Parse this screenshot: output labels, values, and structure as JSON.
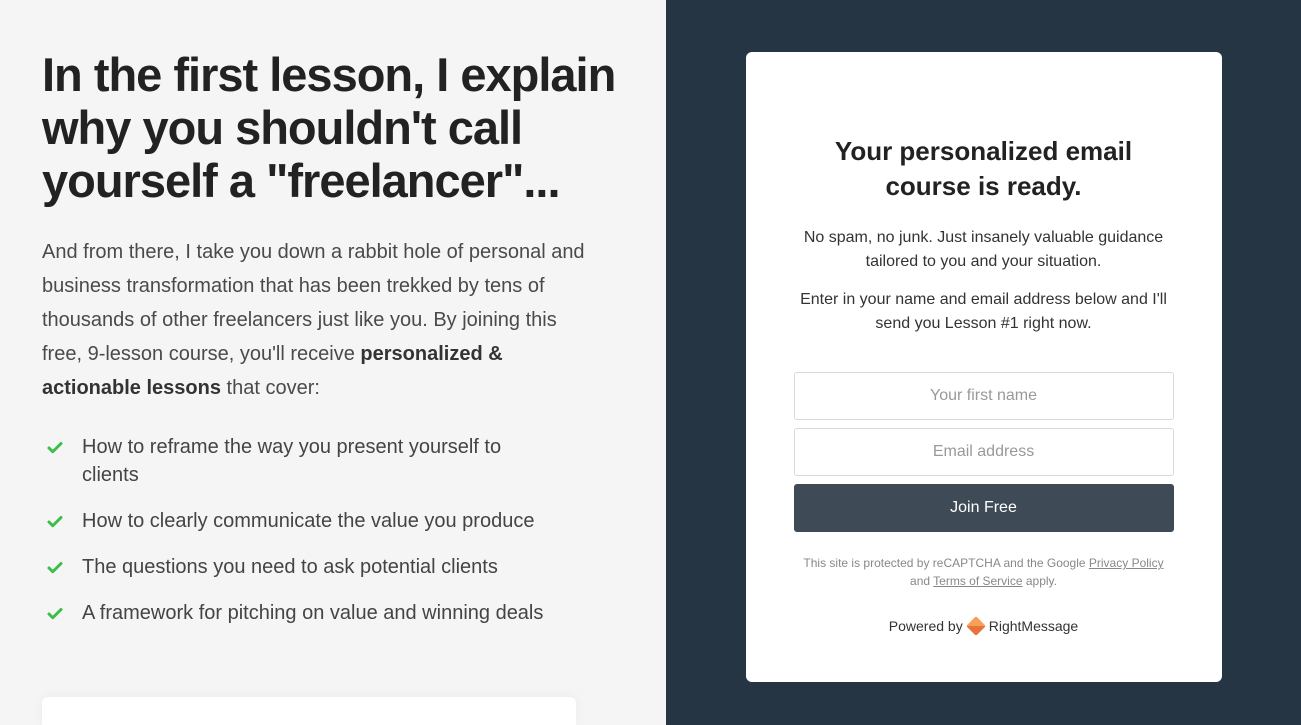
{
  "left": {
    "headline": "In the first lesson, I explain why you shouldn't call yourself a \"freelancer\"...",
    "intro_pre": "And from there, I take you down a rabbit hole of personal and business transformation that has been trekked by tens of thousands of other freelancers just like you. By joining this free, 9-lesson course, you'll receive ",
    "intro_strong": "personalized & actionable lessons",
    "intro_post": " that cover:",
    "bullets": [
      "How to reframe the way you present yourself to clients",
      "How to clearly communicate the value you produce",
      "The questions you need to ask potential clients",
      "A framework for pitching on value and winning deals"
    ]
  },
  "card": {
    "title": "Your personalized email course is ready.",
    "sub1": "No spam, no junk. Just insanely valuable guidance tailored to you and your situation.",
    "sub2": "Enter in your name and email address below and I'll send you Lesson #1 right now.",
    "name_placeholder": "Your first name",
    "email_placeholder": "Email address",
    "submit_label": "Join Free",
    "legal_pre": "This site is protected by reCAPTCHA and the Google ",
    "legal_privacy": "Privacy Policy",
    "legal_and": " and ",
    "legal_tos": "Terms of Service",
    "legal_post": " apply.",
    "powered_pre": "Powered by",
    "powered_brand": "RightMessage"
  }
}
